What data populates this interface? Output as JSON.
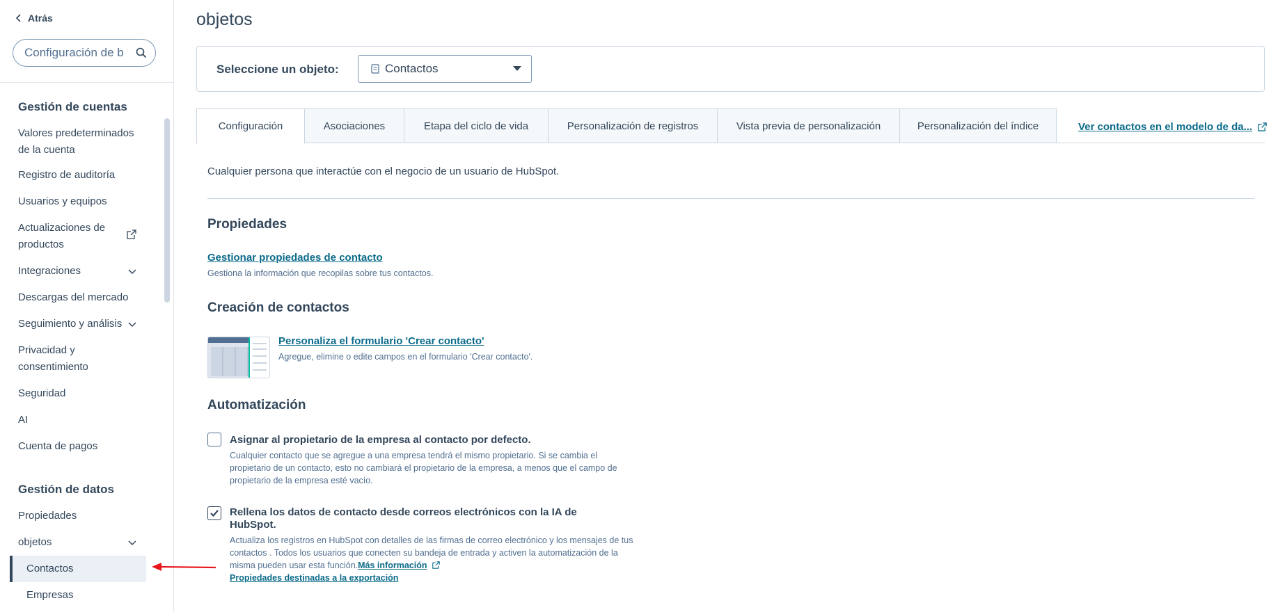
{
  "sidebar": {
    "back_label": "Atrás",
    "search_placeholder": "Configuración de b",
    "sections": [
      {
        "heading": "Gestión de cuentas",
        "items": [
          {
            "label": "Valores predeterminados de la cuenta"
          },
          {
            "label": "Registro de auditoría"
          },
          {
            "label": "Usuarios y equipos"
          },
          {
            "label": "Actualizaciones de productos",
            "icon": "external-link-icon"
          },
          {
            "label": "Integraciones",
            "icon": "chevron-down-icon"
          },
          {
            "label": "Descargas del mercado"
          },
          {
            "label": "Seguimiento y análisis",
            "icon": "chevron-down-icon"
          },
          {
            "label": "Privacidad y consentimiento"
          },
          {
            "label": "Seguridad"
          },
          {
            "label": "AI"
          },
          {
            "label": "Cuenta de pagos"
          }
        ]
      },
      {
        "heading": "Gestión de datos",
        "items": [
          {
            "label": "Propiedades"
          },
          {
            "label": "objetos",
            "icon": "chevron-down-icon"
          },
          {
            "label": "Contactos",
            "active": true
          },
          {
            "label": "Empresas"
          }
        ]
      }
    ]
  },
  "main": {
    "title": "objetos",
    "object_selector": {
      "label": "Seleccione un objeto:",
      "selected": "Contactos"
    },
    "tabs": [
      {
        "label": "Configuración",
        "active": true
      },
      {
        "label": "Asociaciones"
      },
      {
        "label": "Etapa del ciclo de vida"
      },
      {
        "label": "Personalización de registros"
      },
      {
        "label": "Vista previa de personalización"
      },
      {
        "label": "Personalización del índice"
      }
    ],
    "tab_link": "Ver contactos en el modelo de da...",
    "description": "Cualquier persona que interactúe con el negocio de un usuario de HubSpot.",
    "properties": {
      "heading": "Propiedades",
      "link": "Gestionar propiedades de contacto",
      "help": "Gestiona la información que recopilas sobre tus contactos."
    },
    "creation": {
      "heading": "Creación de contactos",
      "link": "Personaliza el formulario 'Crear contacto'",
      "help": "Agregue, elimine o edite campos en el formulario 'Crear contacto'."
    },
    "automation": {
      "heading": "Automatización",
      "option1": {
        "label": "Asignar al propietario de la empresa al contacto por defecto.",
        "desc": "Cualquier contacto que se agregue a una empresa tendrá el mismo propietario. Si se cambia el propietario de un contacto, esto no cambiará el propietario de la empresa, a menos que el campo de propietario de la empresa esté vacío.",
        "checked": false
      },
      "option2": {
        "label": "Rellena los datos de contacto desde correos electrónicos con la IA de HubSpot.",
        "desc": "Actualiza los registros en HubSpot con detalles de las firmas de correo electrónico y los mensajes de tus contactos . Todos los usuarios que conecten su bandeja de entrada y activen la automatización de la misma pueden usar esta función.",
        "more_link": "Más información",
        "export_link": "Propiedades destinadas a la exportación",
        "checked": true
      }
    }
  },
  "colors": {
    "text": "#33475b",
    "link": "#0b6b8a",
    "border": "#cbd6e2",
    "active_bg": "#eaf0f6",
    "annotation_arrow": "#e8161b"
  }
}
